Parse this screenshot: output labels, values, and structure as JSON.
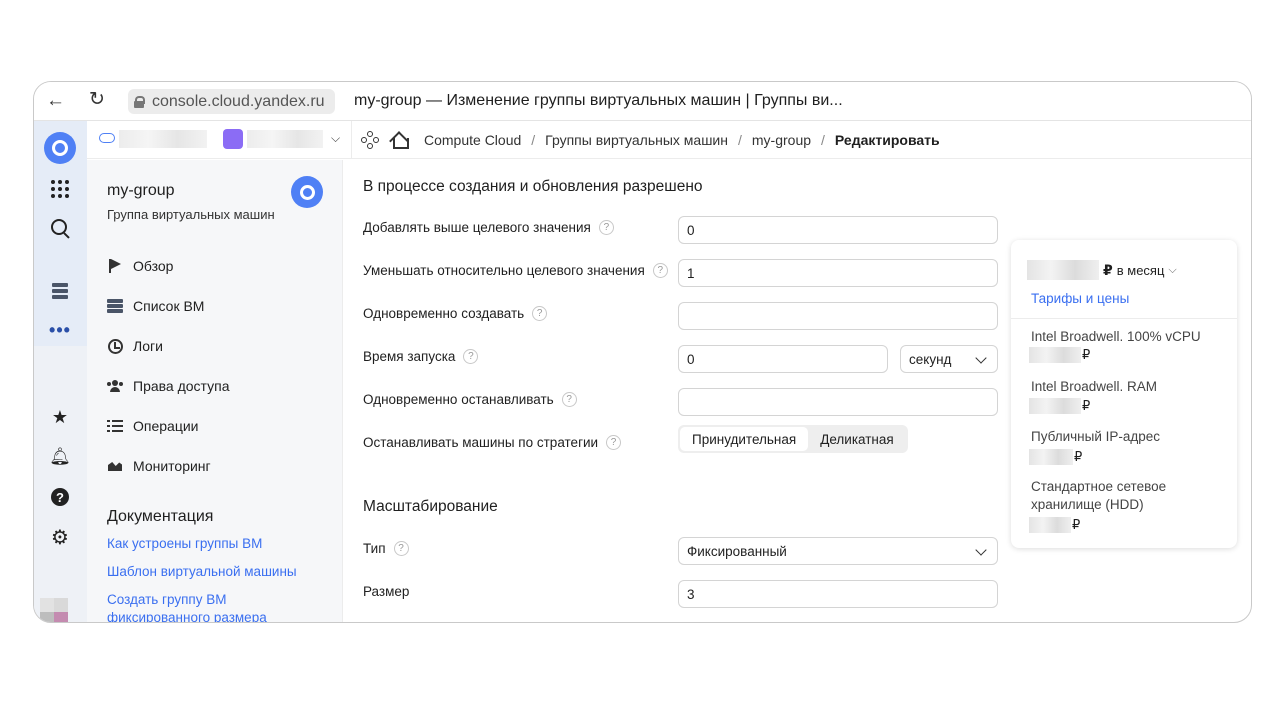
{
  "browser": {
    "url": "console.cloud.yandex.ru",
    "tab_title": "my-group — Изменение группы виртуальных машин | Группы ви..."
  },
  "breadcrumbs": [
    "Compute Cloud",
    "Группы виртуальных машин",
    "my-group",
    "Редактировать"
  ],
  "sidebar": {
    "title": "my-group",
    "subtitle": "Группа виртуальных машин",
    "items": [
      {
        "label": "Обзор",
        "icon": "flag-icon"
      },
      {
        "label": "Список ВМ",
        "icon": "server-list-icon"
      },
      {
        "label": "Логи",
        "icon": "history-icon"
      },
      {
        "label": "Права доступа",
        "icon": "users-icon"
      },
      {
        "label": "Операции",
        "icon": "operations-icon"
      },
      {
        "label": "Мониторинг",
        "icon": "monitoring-icon"
      }
    ],
    "docs_title": "Документация",
    "docs": [
      "Как устроены группы ВМ",
      "Шаблон виртуальной машины",
      "Создать группу ВМ фиксированного размера"
    ]
  },
  "form": {
    "section1_title": "В процессе создания и обновления разрешено",
    "fields": [
      {
        "label": "Добавлять выше целевого значения",
        "value": "0"
      },
      {
        "label": "Уменьшать относительно целевого значения",
        "value": "1"
      },
      {
        "label": "Одновременно создавать",
        "value": ""
      },
      {
        "label": "Время запуска",
        "value": "0",
        "unit": "секунд"
      },
      {
        "label": "Одновременно останавливать",
        "value": ""
      }
    ],
    "strategy_label": "Останавливать машины по стратегии",
    "strategy_options": [
      "Принудительная",
      "Деликатная"
    ],
    "strategy_selected": "Принудительная",
    "section2_title": "Масштабирование",
    "type_label": "Тип",
    "type_value": "Фиксированный",
    "size_label": "Размер",
    "size_value": "3"
  },
  "price": {
    "currency": "₽",
    "period": "в месяц",
    "link": "Тарифы и цены",
    "items": [
      "Intel Broadwell. 100% vCPU",
      "Intel Broadwell. RAM",
      "Публичный IP-адрес",
      "Стандартное сетевое хранилище (HDD)"
    ]
  }
}
